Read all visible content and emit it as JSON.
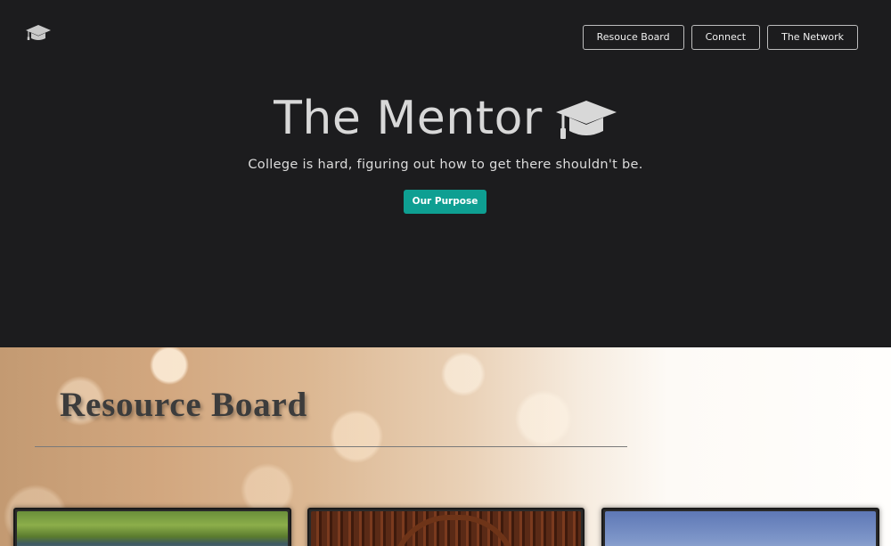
{
  "header": {
    "logo_icon": "graduation-cap-icon",
    "nav": [
      {
        "label": "Resouce Board"
      },
      {
        "label": "Connect"
      },
      {
        "label": "The Network"
      }
    ]
  },
  "hero": {
    "title": "The Mentor",
    "title_icon": "graduation-cap-icon",
    "subtitle": "College is hard, figuring out how to get there shouldn't be.",
    "cta_label": "Our Purpose"
  },
  "resource_board": {
    "title": "Resource Board",
    "cards": [
      {
        "image": "campus-garden-photo"
      },
      {
        "image": "library-arches-photo"
      },
      {
        "image": "blue-sky-photo"
      }
    ]
  },
  "colors": {
    "background": "#1c1c1e",
    "accent": "#0e9f92",
    "text_light": "#d8d8d8"
  }
}
